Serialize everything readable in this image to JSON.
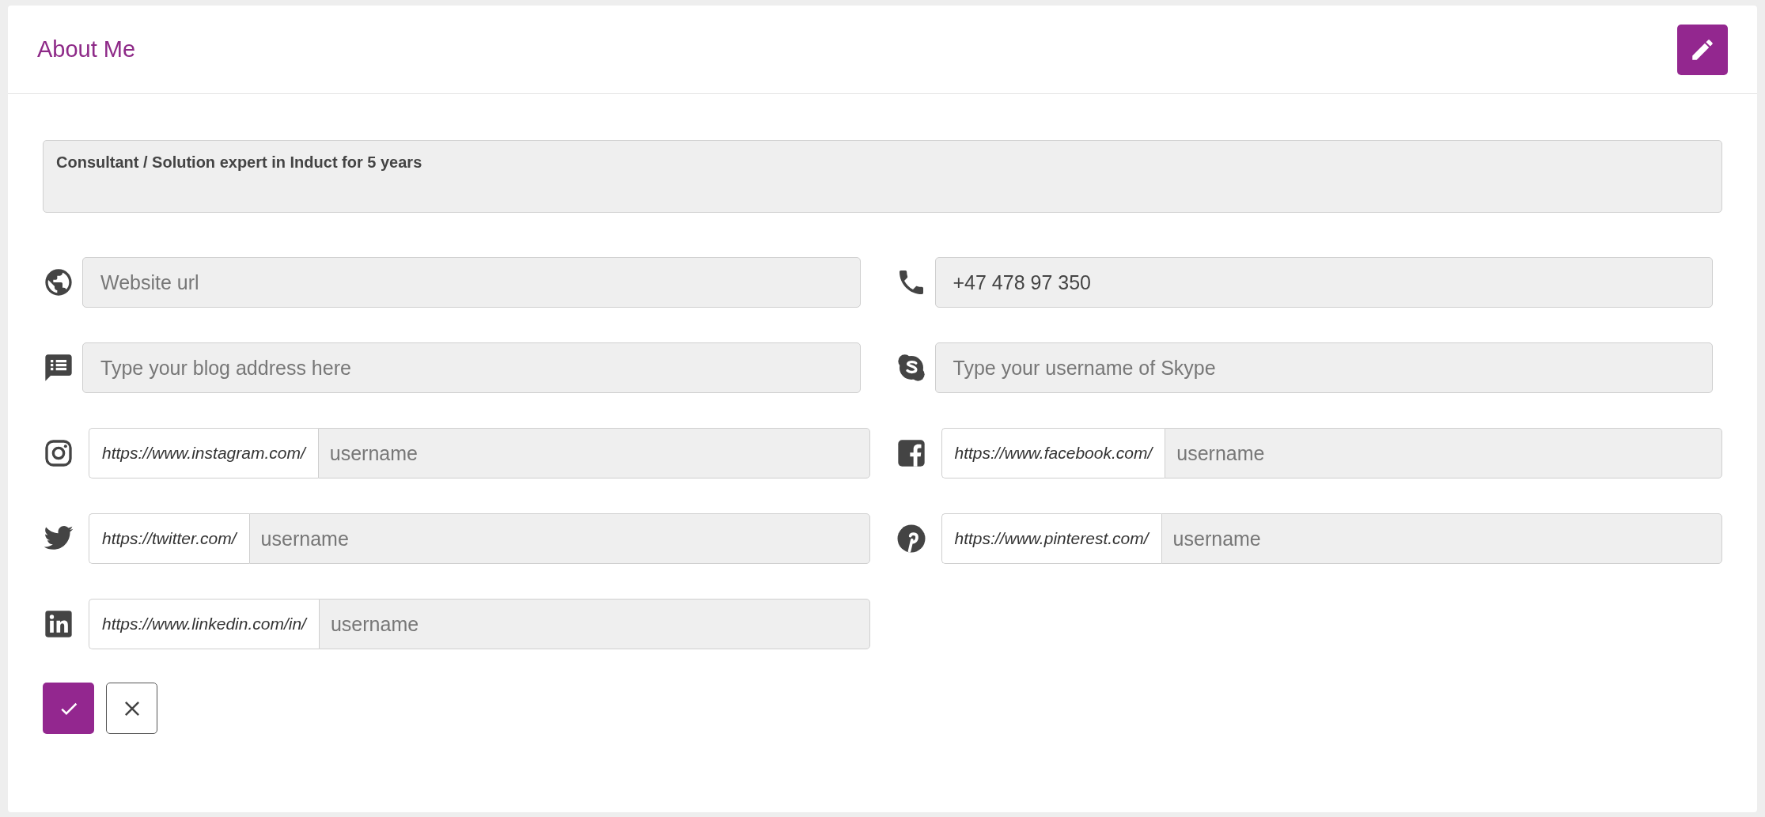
{
  "card": {
    "title": "About Me"
  },
  "description": {
    "value": "Consultant / Solution expert in Induct for 5 years"
  },
  "fields": [
    {
      "kind": "plain",
      "placeholder": "Website url"
    },
    {
      "kind": "plain",
      "value": "+47 478 97 350"
    },
    {
      "kind": "plain",
      "placeholder": "Type your blog address here"
    },
    {
      "kind": "plain",
      "placeholder": "Type your username of Skype"
    },
    {
      "kind": "prefixed",
      "prefix": "https://www.instagram.com/",
      "placeholder": "username"
    },
    {
      "kind": "prefixed",
      "prefix": "https://www.facebook.com/",
      "placeholder": "username"
    },
    {
      "kind": "prefixed",
      "prefix": "https://twitter.com/",
      "placeholder": "username"
    },
    {
      "kind": "prefixed",
      "prefix": "https://www.pinterest.com/",
      "placeholder": "username"
    },
    {
      "kind": "prefixed",
      "prefix": "https://www.linkedin.com/in/",
      "placeholder": "username"
    }
  ]
}
